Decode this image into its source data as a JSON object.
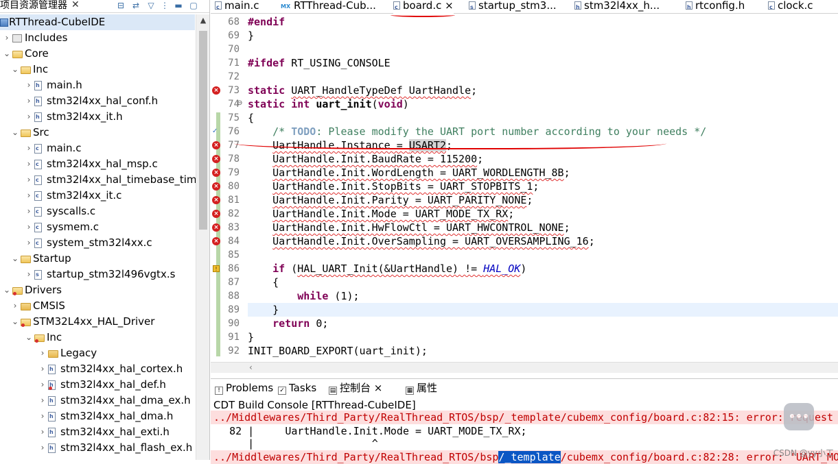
{
  "explorer": {
    "tab_label": "项目资源管理器",
    "items": [
      {
        "label": "RTThread-CubeIDE",
        "depth": 0,
        "expand": "open",
        "icon": "project",
        "selected": true
      },
      {
        "label": "Includes",
        "depth": 1,
        "expand": "closed",
        "icon": "includes"
      },
      {
        "label": "Core",
        "depth": 1,
        "expand": "open",
        "icon": "folder"
      },
      {
        "label": "Inc",
        "depth": 2,
        "expand": "open",
        "icon": "folder"
      },
      {
        "label": "main.h",
        "depth": 3,
        "expand": "closed",
        "icon": "h-file"
      },
      {
        "label": "stm32l4xx_hal_conf.h",
        "depth": 3,
        "expand": "closed",
        "icon": "h-file"
      },
      {
        "label": "stm32l4xx_it.h",
        "depth": 3,
        "expand": "closed",
        "icon": "h-file"
      },
      {
        "label": "Src",
        "depth": 2,
        "expand": "open",
        "icon": "folder"
      },
      {
        "label": "main.c",
        "depth": 3,
        "expand": "closed",
        "icon": "c-file"
      },
      {
        "label": "stm32l4xx_hal_msp.c",
        "depth": 3,
        "expand": "closed",
        "icon": "c-file"
      },
      {
        "label": "stm32l4xx_hal_timebase_tim.",
        "depth": 3,
        "expand": "closed",
        "icon": "c-file"
      },
      {
        "label": "stm32l4xx_it.c",
        "depth": 3,
        "expand": "closed",
        "icon": "c-file"
      },
      {
        "label": "syscalls.c",
        "depth": 3,
        "expand": "closed",
        "icon": "c-file"
      },
      {
        "label": "sysmem.c",
        "depth": 3,
        "expand": "closed",
        "icon": "c-file"
      },
      {
        "label": "system_stm32l4xx.c",
        "depth": 3,
        "expand": "closed",
        "icon": "c-file"
      },
      {
        "label": "Startup",
        "depth": 2,
        "expand": "open",
        "icon": "folder"
      },
      {
        "label": "startup_stm32l496vgtx.s",
        "depth": 3,
        "expand": "closed",
        "icon": "s-file"
      },
      {
        "label": "Drivers",
        "depth": 1,
        "expand": "open",
        "icon": "folder-error"
      },
      {
        "label": "CMSIS",
        "depth": 2,
        "expand": "closed",
        "icon": "folder"
      },
      {
        "label": "STM32L4xx_HAL_Driver",
        "depth": 2,
        "expand": "open",
        "icon": "folder-error"
      },
      {
        "label": "Inc",
        "depth": 3,
        "expand": "open",
        "icon": "folder-error"
      },
      {
        "label": "Legacy",
        "depth": 4,
        "expand": "closed",
        "icon": "folder"
      },
      {
        "label": "stm32l4xx_hal_cortex.h",
        "depth": 4,
        "expand": "closed",
        "icon": "h-file"
      },
      {
        "label": "stm32l4xx_hal_def.h",
        "depth": 4,
        "expand": "closed",
        "icon": "h-file-error"
      },
      {
        "label": "stm32l4xx_hal_dma_ex.h",
        "depth": 4,
        "expand": "closed",
        "icon": "h-file"
      },
      {
        "label": "stm32l4xx_hal_dma.h",
        "depth": 4,
        "expand": "closed",
        "icon": "h-file"
      },
      {
        "label": "stm32l4xx_hal_exti.h",
        "depth": 4,
        "expand": "closed",
        "icon": "h-file"
      },
      {
        "label": "stm32l4xx_hal_flash_ex.h",
        "depth": 4,
        "expand": "closed",
        "icon": "h-file"
      }
    ]
  },
  "editor": {
    "tabs": [
      {
        "label": "main.c",
        "icon": "c-file"
      },
      {
        "label": "RTThread-Cub...",
        "icon": "mx-file"
      },
      {
        "label": "board.c",
        "icon": "c-file",
        "active": true,
        "close": "×"
      },
      {
        "label": "startup_stm3...",
        "icon": "s-file"
      },
      {
        "label": "stm32l4xx_h...",
        "icon": "h-file"
      },
      {
        "label": "rtconfig.h",
        "icon": "h-file"
      },
      {
        "label": "clock.c",
        "icon": "c-file"
      }
    ],
    "lines": [
      {
        "n": "68",
        "marker": "",
        "segs": [
          [
            "pp",
            "#endif"
          ]
        ]
      },
      {
        "n": "69",
        "marker": "",
        "segs": [
          [
            "",
            "}"
          ]
        ]
      },
      {
        "n": "70",
        "marker": "",
        "segs": []
      },
      {
        "n": "71",
        "marker": "",
        "segs": [
          [
            "pp",
            "#ifdef"
          ],
          [
            "",
            " RT_USING_CONSOLE"
          ]
        ]
      },
      {
        "n": "72",
        "marker": "",
        "segs": []
      },
      {
        "n": "73",
        "marker": "error",
        "segs": [
          [
            "kw",
            "static"
          ],
          [
            "",
            " "
          ],
          [
            "sq",
            "UART_HandleTypeDef UartHandle"
          ],
          [
            "",
            ";"
          ]
        ]
      },
      {
        "n": "74",
        "marker": "fold",
        "segs": [
          [
            "kw",
            "static"
          ],
          [
            "",
            " "
          ],
          [
            "kw",
            "int"
          ],
          [
            "",
            " "
          ],
          [
            "b",
            "uart_init"
          ],
          [
            "",
            "("
          ],
          [
            "kw",
            "void"
          ],
          [
            "",
            ")"
          ]
        ]
      },
      {
        "n": "75",
        "marker": "",
        "segs": [
          [
            "",
            "{"
          ]
        ]
      },
      {
        "n": "76",
        "marker": "task",
        "segs": [
          [
            "",
            "    "
          ],
          [
            "cm",
            "/* "
          ],
          [
            "todo",
            "TODO"
          ],
          [
            "cm",
            ": Please modify the UART port number according to your needs */"
          ]
        ]
      },
      {
        "n": "77",
        "marker": "error",
        "segs": [
          [
            "",
            "    "
          ],
          [
            "sq",
            "UartHandle.Instance = "
          ],
          [
            "sqhl",
            "USART2"
          ],
          [
            "",
            ";"
          ]
        ]
      },
      {
        "n": "78",
        "marker": "error",
        "segs": [
          [
            "",
            "    "
          ],
          [
            "sq",
            "UartHandle.Init.BaudRate = 115200"
          ],
          [
            "",
            ";"
          ]
        ]
      },
      {
        "n": "79",
        "marker": "error",
        "segs": [
          [
            "",
            "    "
          ],
          [
            "sq",
            "UartHandle.Init.WordLength = UART_WORDLENGTH_8B"
          ],
          [
            "",
            ";"
          ]
        ]
      },
      {
        "n": "80",
        "marker": "error",
        "segs": [
          [
            "",
            "    "
          ],
          [
            "sq",
            "UartHandle.Init.StopBits = UART_STOPBITS_1"
          ],
          [
            "",
            ";"
          ]
        ]
      },
      {
        "n": "81",
        "marker": "error",
        "segs": [
          [
            "",
            "    "
          ],
          [
            "sq",
            "UartHandle.Init.Parity = UART_PARITY_NONE"
          ],
          [
            "",
            ";"
          ]
        ]
      },
      {
        "n": "82",
        "marker": "error",
        "segs": [
          [
            "",
            "    "
          ],
          [
            "sq",
            "UartHandle.Init.Mode = UART_MODE_TX_RX"
          ],
          [
            "",
            ";"
          ]
        ]
      },
      {
        "n": "83",
        "marker": "error",
        "segs": [
          [
            "",
            "    "
          ],
          [
            "sq",
            "UartHandle.Init.HwFlowCtl = UART_HWCONTROL_NONE"
          ],
          [
            "",
            ";"
          ]
        ]
      },
      {
        "n": "84",
        "marker": "error",
        "segs": [
          [
            "",
            "    "
          ],
          [
            "sq",
            "UartHandle.Init.OverSampling = UART_OVERSAMPLING_16"
          ],
          [
            "",
            ";"
          ]
        ]
      },
      {
        "n": "85",
        "marker": "",
        "segs": []
      },
      {
        "n": "86",
        "marker": "warning",
        "segs": [
          [
            "",
            "    "
          ],
          [
            "kw",
            "if"
          ],
          [
            "",
            " ("
          ],
          [
            "sq",
            "HAL_UART_Init(&UartHandle) != "
          ],
          [
            "itsq",
            "HAL_OK"
          ],
          [
            "",
            ")"
          ]
        ]
      },
      {
        "n": "87",
        "marker": "",
        "segs": [
          [
            "",
            "    {"
          ]
        ]
      },
      {
        "n": "88",
        "marker": "",
        "segs": [
          [
            "",
            "        "
          ],
          [
            "kw",
            "while"
          ],
          [
            "",
            " (1);"
          ]
        ]
      },
      {
        "n": "89",
        "marker": "",
        "segs": [
          [
            "",
            "    }"
          ]
        ],
        "current": true
      },
      {
        "n": "90",
        "marker": "",
        "segs": [
          [
            "",
            "    "
          ],
          [
            "kw",
            "return"
          ],
          [
            "",
            " 0;"
          ]
        ]
      },
      {
        "n": "91",
        "marker": "",
        "segs": [
          [
            "",
            "}"
          ]
        ]
      },
      {
        "n": "92",
        "marker": "",
        "segs": [
          [
            "",
            "INIT_BOARD_EXPORT(uart_init);"
          ]
        ]
      }
    ]
  },
  "console": {
    "tabs": [
      {
        "label": "Problems",
        "icon": "problems-icon"
      },
      {
        "label": "Tasks",
        "icon": "tasks-icon"
      },
      {
        "label": "控制台",
        "icon": "console-icon",
        "active": true,
        "close": "×"
      },
      {
        "label": "属性",
        "icon": "properties-icon"
      }
    ],
    "title": "CDT Build Console [RTThread-CubeIDE]",
    "line1": "../Middlewares/Third_Party/RealThread_RTOS/bsp/_template/cubemx_config/board.c:82:15: error: request",
    "line2": "   82 |     UartHandle.Init.Mode = UART_MODE_TX_RX;",
    "line3": "      |                   ^",
    "line4_pre": "../Middlewares/Third_Party/RealThread_RTOS/bsp",
    "line4_sel": "/_template",
    "line4_post": "/cubemx_config/board.c:82:28: error: 'UART_MO"
  },
  "watermark": "CSDN @yy小工",
  "colors": {
    "error": "#d42020",
    "keyword": "#7f0055",
    "comment": "#3f7f5f",
    "annotation": "#e00000"
  }
}
